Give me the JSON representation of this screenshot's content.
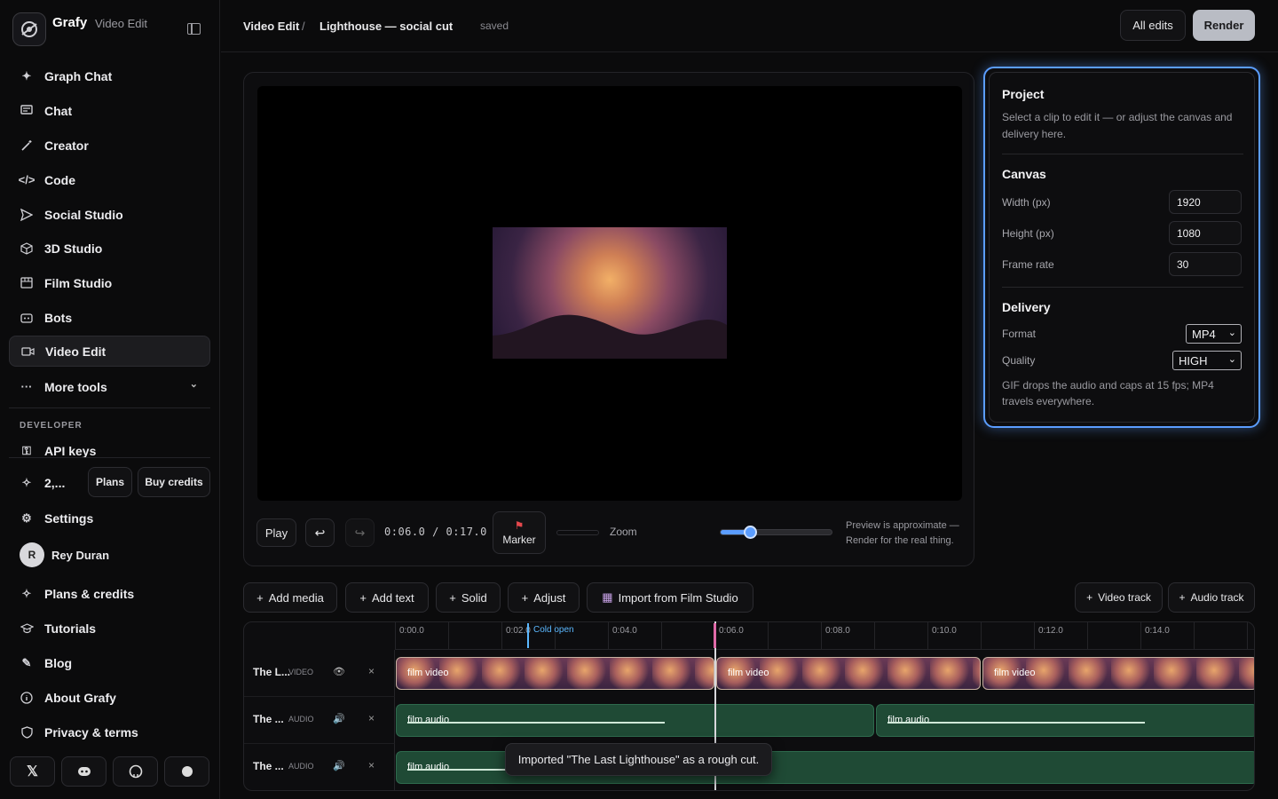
{
  "app": {
    "name": "Grafy",
    "section": "Video Edit"
  },
  "sidebar": {
    "items": [
      {
        "label": "Graph Chat",
        "icon": "sparkle-icon"
      },
      {
        "label": "Chat",
        "icon": "chat-icon"
      },
      {
        "label": "Creator",
        "icon": "wand-icon"
      },
      {
        "label": "Code",
        "icon": "code-icon"
      },
      {
        "label": "Social Studio",
        "icon": "send-icon"
      },
      {
        "label": "3D Studio",
        "icon": "cube-icon"
      },
      {
        "label": "Film Studio",
        "icon": "film-icon"
      },
      {
        "label": "Bots",
        "icon": "bot-icon"
      },
      {
        "label": "Video Edit",
        "icon": "video-icon"
      },
      {
        "label": "More tools",
        "icon": "more-icon"
      }
    ],
    "developer_heading": "DEVELOPER",
    "api_keys": "API keys",
    "credits_short": "2,...",
    "plans_btn": "Plans",
    "buy_btn": "Buy credits",
    "settings": "Settings",
    "user": {
      "initial": "R",
      "name": "Rey Duran"
    },
    "bottom": [
      "Plans & credits",
      "Tutorials",
      "Blog",
      "About Grafy",
      "Privacy & terms"
    ]
  },
  "topbar": {
    "crumb1": "Video Edit",
    "sep": "/",
    "crumb2": "Lighthouse — social cut",
    "status": "saved",
    "all_edits": "All edits",
    "render": "Render"
  },
  "player": {
    "play": "Play",
    "timecode": "0:06.0 / 0:17.0",
    "marker": "Marker",
    "zoom": "Zoom",
    "zoom_level": 0.26,
    "note1": "Preview is approximate —",
    "note2": "Render for the real thing."
  },
  "project": {
    "title": "Project",
    "desc1": "Select a clip to edit it — or adjust the canvas and",
    "desc2": "delivery here.",
    "canvas_title": "Canvas",
    "width_label": "Width (px)",
    "width": "1920",
    "height_label": "Height (px)",
    "height": "1080",
    "fps_label": "Frame rate",
    "fps": "30",
    "delivery_title": "Delivery",
    "format_label": "Format",
    "format": "MP4",
    "quality_label": "Quality",
    "quality": "HIGH",
    "hint1": "GIF drops the audio and caps at 15 fps; MP4",
    "hint2": "travels everywhere."
  },
  "toolbar": {
    "add_media": "Add media",
    "add_text": "Add text",
    "solid": "Solid",
    "adjust": "Adjust",
    "import": "Import from Film Studio",
    "video_track": "Video track",
    "audio_track": "Audio track"
  },
  "timeline": {
    "ticks": [
      "0:00.0",
      "0:02.0",
      "0:04.0",
      "0:06.0",
      "0:08.0",
      "0:10.0",
      "0:12.0",
      "0:14.0"
    ],
    "marker_label": "Cold open",
    "tracks": [
      {
        "name": "The L...",
        "kind": "VIDEO"
      },
      {
        "name": "The ...",
        "kind": "AUDIO"
      },
      {
        "name": "The ...",
        "kind": "AUDIO"
      }
    ],
    "video_clip": "film video",
    "audio_clip": "film audio"
  },
  "toast": "Imported \"The Last Lighthouse\" as a rough cut."
}
